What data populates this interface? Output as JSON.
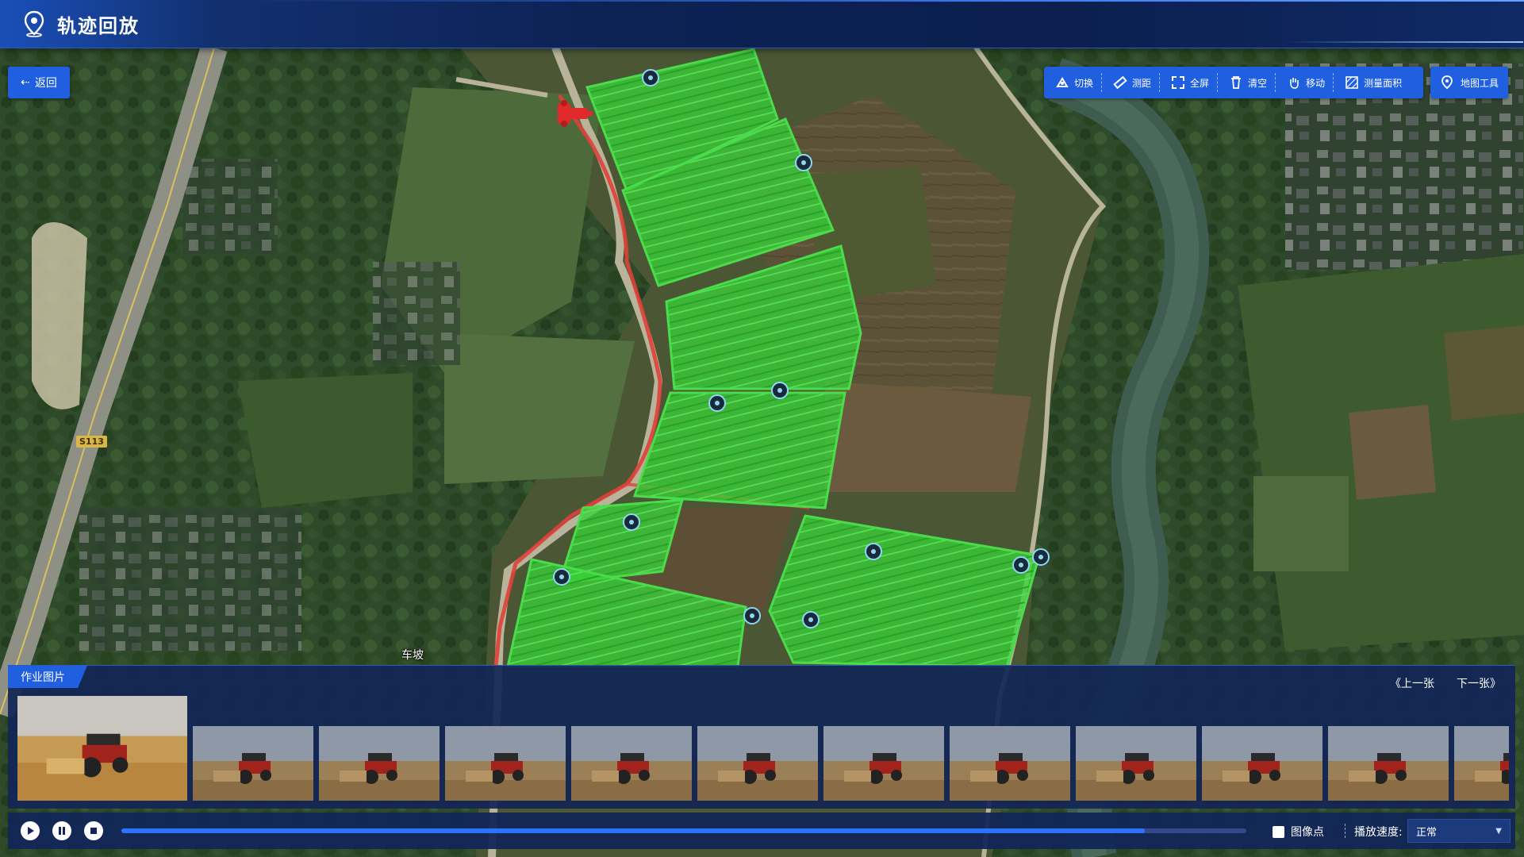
{
  "header": {
    "title": "轨迹回放"
  },
  "back": {
    "label": "返回"
  },
  "toolbar": {
    "items": [
      {
        "label": "切换",
        "icon": "switch-icon"
      },
      {
        "label": "测距",
        "icon": "ruler-icon"
      },
      {
        "label": "全屏",
        "icon": "fullscreen-icon"
      },
      {
        "label": "清空",
        "icon": "trash-icon"
      },
      {
        "label": "移动",
        "icon": "hand-icon"
      },
      {
        "label": "测量面积",
        "icon": "area-icon"
      }
    ],
    "map_tools": {
      "label": "地图工具",
      "icon": "map-pin-icon"
    }
  },
  "map": {
    "place_label": "车坡",
    "road_label": "S113",
    "track_color": "#3ad13a",
    "path_color": "#e0403a"
  },
  "photos": {
    "title": "作业图片",
    "prev": "《上一张",
    "next": "下一张》",
    "thumbnail_count": 12
  },
  "playback": {
    "play_icon": "play-icon",
    "pause_icon": "pause-icon",
    "stop_icon": "stop-icon",
    "progress": 0.91,
    "image_points_label": "图像点",
    "image_points_checked": false,
    "speed_label": "播放速度:",
    "speed_value": "正常"
  },
  "colors": {
    "accent": "#1f5fe0",
    "panel": "#122656",
    "progress": "#2b73ff"
  }
}
